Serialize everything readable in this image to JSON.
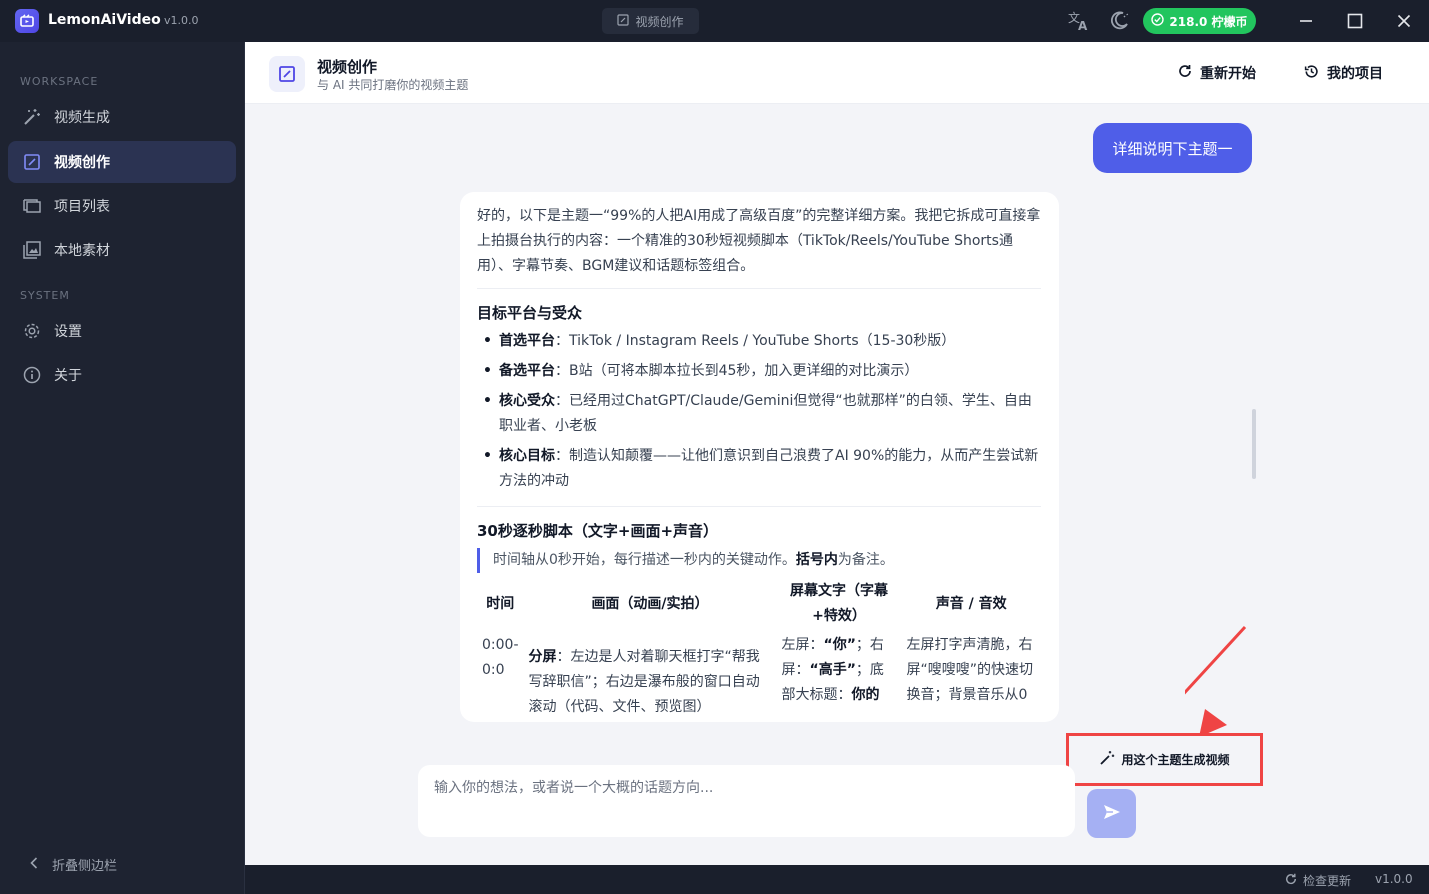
{
  "app": {
    "name": "LemonAiVideo",
    "version": "v1.0.0",
    "center_tab": "视频创作",
    "coins": "218.0 柠檬币"
  },
  "sidebar": {
    "workspace_label": "WORKSPACE",
    "system_label": "SYSTEM",
    "items": [
      {
        "label": "视频生成",
        "icon": "wand-icon"
      },
      {
        "label": "视频创作",
        "icon": "edit-icon",
        "active": true
      },
      {
        "label": "项目列表",
        "icon": "folder-icon"
      },
      {
        "label": "本地素材",
        "icon": "image-icon"
      }
    ],
    "system_items": [
      {
        "label": "设置",
        "icon": "gear-icon"
      },
      {
        "label": "关于",
        "icon": "info-icon"
      }
    ],
    "collapse_label": "折叠侧边栏"
  },
  "header": {
    "title": "视频创作",
    "subtitle": "与 AI 共同打磨你的视频主题",
    "restart_label": "重新开始",
    "projects_label": "我的项目"
  },
  "chat": {
    "user_message": "详细说明下主题一",
    "ai": {
      "intro": "好的，以下是主题一“99%的人把AI用成了高级百度”的完整详细方案。我把它拆成可直接拿上拍摄台执行的内容：一个精准的30秒短视频脚本（TikTok/Reels/YouTube Shorts通用）、字幕节奏、BGM建议和话题标签组合。",
      "section1_title": "目标平台与受众",
      "bullets": [
        {
          "key": "首选平台",
          "sep": "：",
          "text": "TikTok / Instagram Reels / YouTube Shorts（15-30秒版）"
        },
        {
          "key": "备选平台",
          "sep": "：",
          "text": "B站（可将本脚本拉长到45秒，加入更详细的对比演示）"
        },
        {
          "key": "核心受众",
          "sep": "：",
          "text": "已经用过ChatGPT/Claude/Gemini但觉得“也就那样”的白领、学生、自由职业者、小老板"
        },
        {
          "key": "核心目标",
          "sep": "：",
          "text": "制造认知颠覆——让他们意识到自己浪费了AI 90%的能力，从而产生尝试新方法的冲动"
        }
      ],
      "section2_title": "30秒逐秒脚本（文字+画面+声音）",
      "quote_text": "时间轴从0秒开始，每行描述一秒内的关键动作。",
      "quote_bold": "括号内",
      "quote_tail": "为备注。",
      "table": {
        "headers": [
          "时间",
          "画面（动画/实拍）",
          "屏幕文字（字幕+特效）",
          "声音 / 音效"
        ],
        "row1": {
          "time": "0:00-0:0",
          "visual_key": "分屏",
          "visual_text": "：左边是人对着聊天框打字“帮我写辞职信”；右边是瀑布般的窗口自动滚动（代码、文件、预览图）",
          "screen_a": "左屏：",
          "screen_b": "“你”",
          "screen_c": "；右屏：",
          "screen_d": "“高手”",
          "screen_e": "；底部大标题：",
          "screen_f": "你的",
          "sound": "左屏打字声清脆，右屏“嗖嗖嗖”的快速切换音；背景音乐从0"
        }
      }
    }
  },
  "generate_button": "用这个主题生成视频",
  "input": {
    "placeholder": "输入你的想法，或者说一个大概的话题方向..."
  },
  "status": {
    "check_update": "检查更新",
    "version": "v1.0.0"
  }
}
